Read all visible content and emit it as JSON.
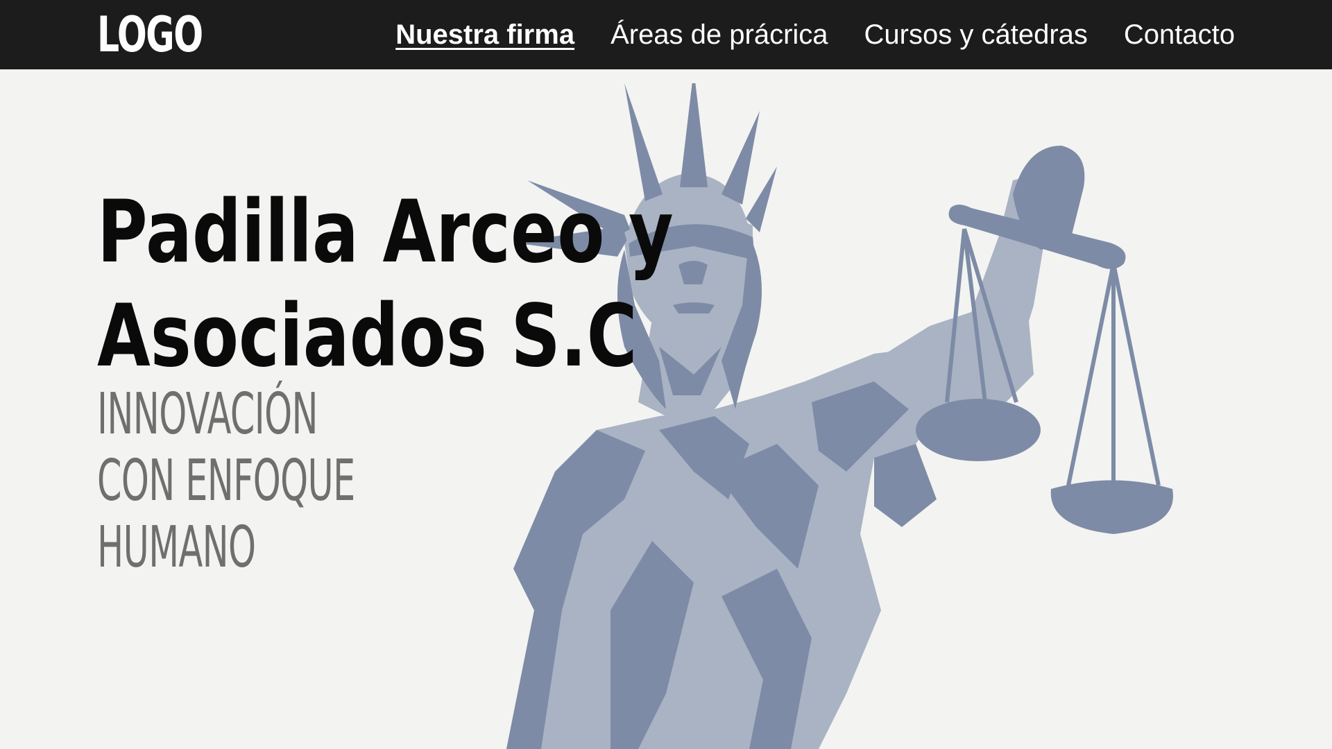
{
  "header": {
    "logo": "LOGO",
    "nav": [
      {
        "label": "Nuestra firma",
        "active": true
      },
      {
        "label": "Áreas de prácrica",
        "active": false
      },
      {
        "label": "Cursos y cátedras",
        "active": false
      },
      {
        "label": "Contacto",
        "active": false
      }
    ]
  },
  "hero": {
    "title_line1": "Padilla Arceo y",
    "title_line2": "Asociados S.C",
    "tagline_line1": "INNOVACIÓN",
    "tagline_line2": "CON ENFOQUE",
    "tagline_line3": "HUMANO",
    "image_icon": "lady-justice-illustration"
  },
  "colors": {
    "nav_background": "#1c1c1c",
    "page_background": "#f3f3f1",
    "title": "#0a0a0a",
    "tagline": "#6f6f6f",
    "statue_dark": "#7d8ba6",
    "statue_light": "#a9b3c3"
  }
}
